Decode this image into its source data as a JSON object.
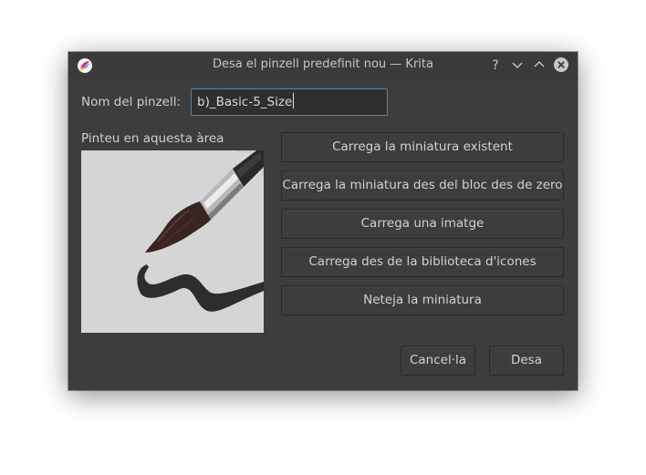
{
  "window": {
    "title": "Desa el pinzell predefinit nou — Krita",
    "app_icon": "krita-icon",
    "controls": {
      "help": "?",
      "minimize": "chevron-down-icon",
      "maximize": "chevron-up-icon",
      "close": "close-icon"
    }
  },
  "form": {
    "name_label": "Nom del pinzell:",
    "name_value": "b)_Basic-5_Size",
    "paint_area_label": "Pinteu en aquesta àrea"
  },
  "actions": {
    "load_existing": "Carrega la miniatura existent",
    "load_from_scratchpad": "Carrega la miniatura des del bloc des de zero",
    "load_image": "Carrega una imatge",
    "load_icon_library": "Carrega des de la biblioteca d'icones",
    "clear_thumbnail": "Neteja la miniatura"
  },
  "footer": {
    "cancel": "Cancel·la",
    "save": "Desa"
  },
  "colors": {
    "dialog_bg": "#3d3d3d",
    "focus_border": "#3f8fbd",
    "preview_bg": "#d5d5d5"
  }
}
